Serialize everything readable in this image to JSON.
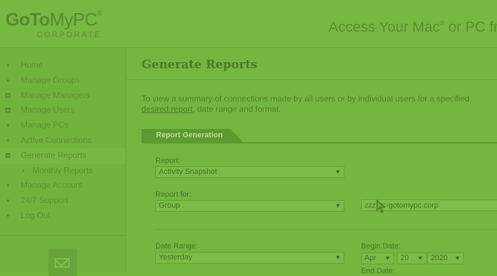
{
  "header": {
    "logo_main_bold": "GoTo",
    "logo_main_light": "MyPC",
    "logo_reg": "®",
    "logo_sub": "CORPORATE",
    "tagline": "Access Your Mac",
    "tagline_reg": "®",
    "tagline_rest": " or PC fr"
  },
  "sidebar": {
    "items": [
      {
        "label": "Home",
        "marker": "bullet"
      },
      {
        "label": "Manage Groups",
        "marker": "bullet"
      },
      {
        "label": "Manage Managers",
        "marker": "plus"
      },
      {
        "label": "Manage Users",
        "marker": "plus"
      },
      {
        "label": "Manage PCs",
        "marker": "bullet"
      },
      {
        "label": "Active Connections",
        "marker": "bullet"
      },
      {
        "label": "Generate Reports",
        "marker": "minus",
        "active": true
      },
      {
        "label": "Monthly Reports",
        "marker": "bullet",
        "sub": true
      },
      {
        "label": "Manage Account",
        "marker": "bullet"
      },
      {
        "label": "24/7 Support",
        "marker": "bullet"
      },
      {
        "label": "Log Out",
        "marker": "bullet"
      }
    ],
    "mail_icon": "mail-icon"
  },
  "main": {
    "title": "Generate Reports",
    "intro_line1": "To view a summary of connections made by all users or by individual users for a specified",
    "intro_link": "desired report",
    "intro_rest": ", date range and format.",
    "tab_label": "Report Generation",
    "report_label": "Report:",
    "report_value": "Activity Snapshot",
    "report_for_label": "Report for:",
    "report_for_value": "Group",
    "group_value": "zzz...c-gotomypc.corp",
    "date_range_label": "Date Range:",
    "date_range_value": "Yesterday",
    "begin_date_label": "Begin Date:",
    "begin_month": "Apr",
    "begin_day": "20",
    "begin_year": "2020",
    "end_date_label": "End Date:"
  },
  "colors": {
    "overlay_green": "#72b63d",
    "text_dark": "#4c7a27",
    "tab_bg": "#5d9a2f"
  }
}
